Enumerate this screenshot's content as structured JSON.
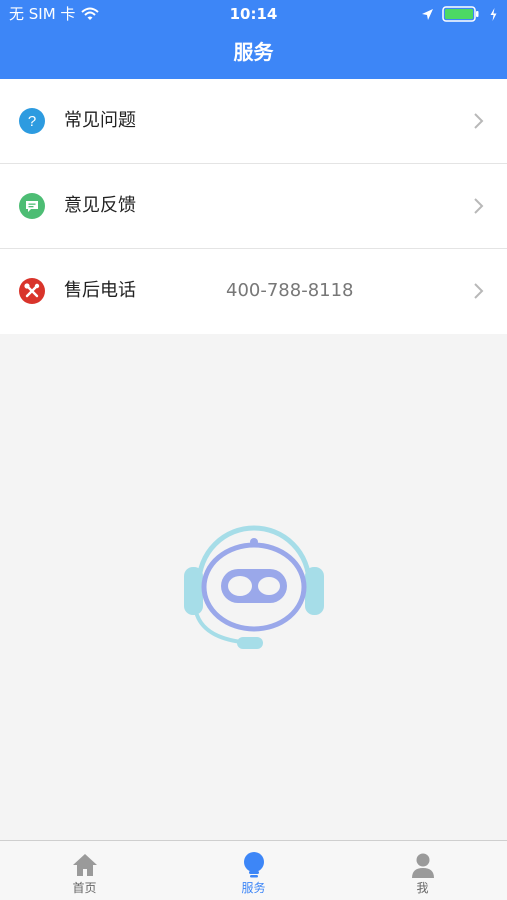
{
  "status_bar": {
    "carrier": "无 SIM 卡",
    "time": "10:14"
  },
  "header": {
    "title": "服务"
  },
  "menu": {
    "items": [
      {
        "label": "常见问题",
        "icon": "question-icon",
        "color": "#2d9be0"
      },
      {
        "label": "意见反馈",
        "icon": "feedback-icon",
        "color": "#4dbd74"
      },
      {
        "label": "售后电话",
        "value": "400-788-8118",
        "icon": "tools-icon",
        "color": "#d9342b"
      }
    ]
  },
  "tabbar": {
    "active": 1,
    "tabs": [
      {
        "label": "首页",
        "icon": "home-icon"
      },
      {
        "label": "服务",
        "icon": "bulb-icon"
      },
      {
        "label": "我",
        "icon": "person-icon"
      }
    ]
  },
  "colors": {
    "primary": "#3d86f7",
    "background": "#f4f4f4",
    "robot_ring": "#9aa8ea",
    "robot_accent": "#a6dde8"
  }
}
